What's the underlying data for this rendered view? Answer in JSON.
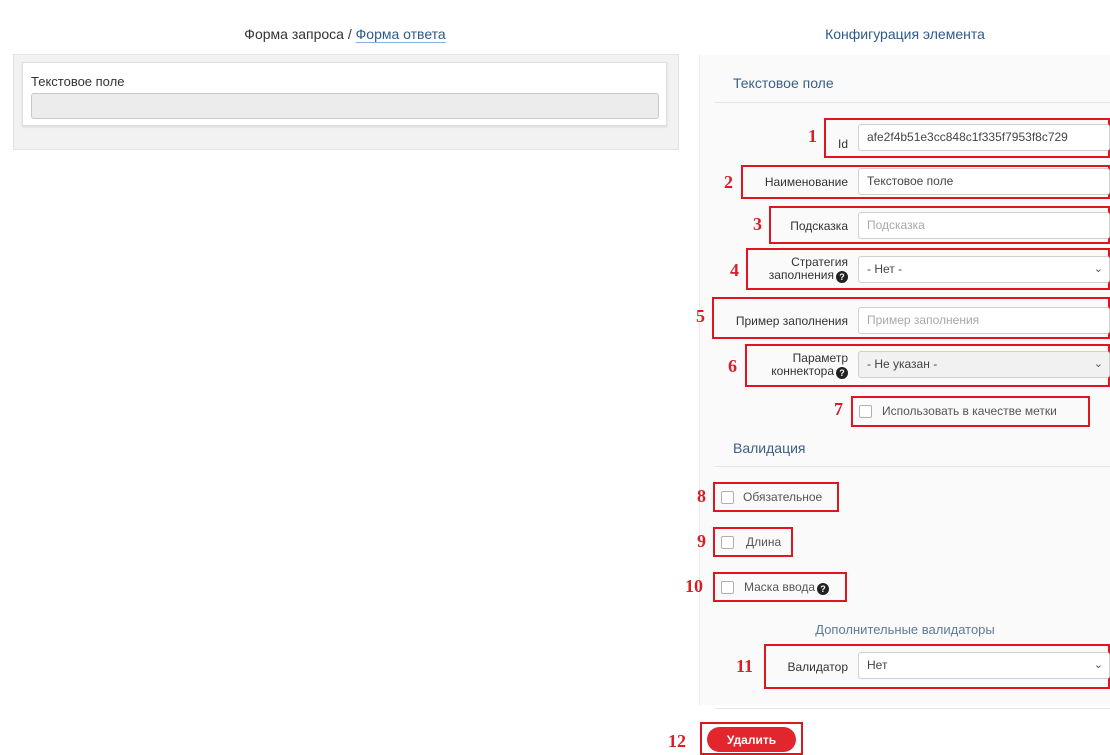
{
  "left": {
    "header_request": "Форма запроса",
    "header_separator": " / ",
    "header_response": "Форма ответа",
    "field_label": "Текстовое поле"
  },
  "right": {
    "header": "Конфигурация элемента",
    "element_title": "Текстовое поле",
    "fields": {
      "id": {
        "marker": "1",
        "label": "Id",
        "value": "afe2f4b51e3cc848c1f335f7953f8c729"
      },
      "name": {
        "marker": "2",
        "label": "Наименование",
        "value": "Текстовое поле"
      },
      "hint": {
        "marker": "3",
        "label": "Подсказка",
        "placeholder": "Подсказка"
      },
      "strategy": {
        "marker": "4",
        "label_line1": "Стратегия",
        "label_line2": "заполнения",
        "selected": "- Нет -",
        "icon": "question-circle-icon"
      },
      "example": {
        "marker": "5",
        "label": "Пример заполнения",
        "placeholder": "Пример заполнения"
      },
      "connector": {
        "marker": "6",
        "label_line1": "Параметр",
        "label_line2": "коннектора",
        "selected": "- Не указан -",
        "icon": "question-circle-icon"
      },
      "use_as_label": {
        "marker": "7",
        "label": "Использовать в качестве метки",
        "checked": false
      }
    },
    "validation": {
      "title": "Валидация",
      "required": {
        "marker": "8",
        "label": "Обязательное",
        "checked": false
      },
      "length": {
        "marker": "9",
        "label": "Длина",
        "checked": false
      },
      "mask": {
        "marker": "10",
        "label": "Маска ввода",
        "checked": false,
        "icon": "question-circle-icon"
      },
      "extra_title": "Дополнительные валидаторы",
      "validator": {
        "marker": "11",
        "label": "Валидатор",
        "selected": "Нет"
      }
    },
    "delete": {
      "marker": "12",
      "label": "Удалить"
    }
  },
  "colors": {
    "accent_blue": "#2e5a8a",
    "annotation_red": "#e0151f",
    "delete_red": "#e3262e"
  }
}
